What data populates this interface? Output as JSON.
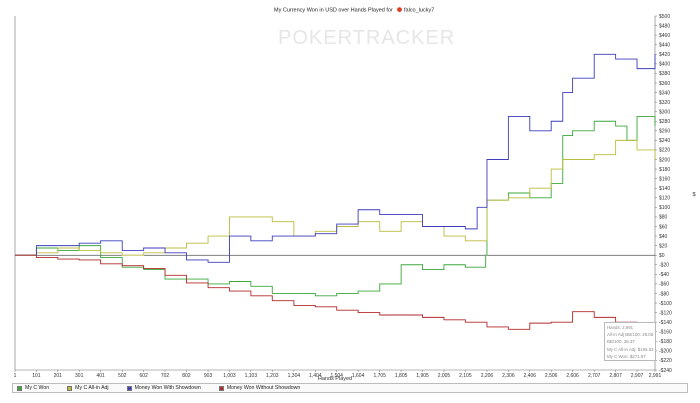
{
  "chart_data": {
    "type": "line",
    "title": "My Currency Won in USD over Hands Played for",
    "player_name": "falco_lucky7",
    "watermark": "POKERTRACKER",
    "xlabel": "Hands Played",
    "ylabel": "$",
    "xlim": [
      1,
      2991
    ],
    "ylim": [
      -240,
      500
    ],
    "x_ticks": [
      1,
      101,
      201,
      301,
      401,
      502,
      602,
      702,
      802,
      903,
      1003,
      1103,
      1203,
      1304,
      1404,
      1504,
      1604,
      1705,
      1805,
      1905,
      2005,
      2105,
      2206,
      2306,
      2406,
      2506,
      2606,
      2707,
      2807,
      2907,
      2991
    ],
    "x_tick_labels": [
      "1",
      "101",
      "201",
      "301",
      "401",
      "502",
      "602",
      "702",
      "802",
      "903",
      "1,003",
      "1,103",
      "1,203",
      "1,304",
      "1,404",
      "1,504",
      "1,604",
      "1,705",
      "1,805",
      "1,905",
      "2,005",
      "2,105",
      "2,206",
      "2,306",
      "2,406",
      "2,506",
      "2,606",
      "2,707",
      "2,807",
      "2,907",
      "2,991"
    ],
    "y_ticks": [
      -240,
      -220,
      -200,
      -180,
      -160,
      -140,
      -120,
      -100,
      -80,
      -60,
      -40,
      -20,
      0,
      20,
      40,
      60,
      80,
      100,
      120,
      140,
      160,
      180,
      200,
      220,
      240,
      260,
      280,
      300,
      320,
      340,
      360,
      380,
      400,
      420,
      440,
      460,
      480,
      500
    ],
    "y_tick_labels": [
      "-$240",
      "-$220",
      "-$200",
      "-$180",
      "-$160",
      "-$140",
      "-$120",
      "-$100",
      "-$80",
      "-$60",
      "-$40",
      "-$20",
      "$0",
      "$20",
      "$40",
      "$60",
      "$80",
      "$100",
      "$120",
      "$140",
      "$160",
      "$180",
      "$200",
      "$220",
      "$240",
      "$260",
      "$280",
      "$300",
      "$320",
      "$340",
      "$360",
      "$380",
      "$400",
      "$420",
      "$440",
      "$460",
      "$480",
      "$500"
    ],
    "grid": false,
    "legend_position": "bottom",
    "series": [
      {
        "name": "My C Won",
        "color": "#3aa83a",
        "x": [
          1,
          101,
          201,
          301,
          401,
          502,
          602,
          702,
          802,
          903,
          1003,
          1103,
          1203,
          1304,
          1404,
          1504,
          1604,
          1705,
          1805,
          1905,
          2005,
          2105,
          2160,
          2200,
          2206,
          2306,
          2406,
          2506,
          2560,
          2606,
          2707,
          2807,
          2860,
          2907,
          2991
        ],
        "y": [
          0,
          15,
          10,
          20,
          -5,
          -25,
          -30,
          -50,
          -50,
          -60,
          -55,
          -65,
          -80,
          -80,
          -85,
          -80,
          -75,
          -60,
          -20,
          -30,
          -20,
          -25,
          -25,
          0,
          115,
          130,
          120,
          150,
          250,
          260,
          280,
          270,
          240,
          290,
          270
        ]
      },
      {
        "name": "My C All-in Adj",
        "color": "#bcbc3c",
        "x": [
          1,
          101,
          201,
          301,
          401,
          502,
          602,
          702,
          802,
          903,
          1003,
          1103,
          1203,
          1304,
          1404,
          1504,
          1604,
          1705,
          1805,
          1905,
          2005,
          2105,
          2160,
          2206,
          2306,
          2406,
          2506,
          2560,
          2606,
          2707,
          2807,
          2907,
          2991
        ],
        "y": [
          0,
          5,
          15,
          10,
          5,
          0,
          5,
          15,
          25,
          40,
          80,
          80,
          70,
          40,
          50,
          60,
          70,
          50,
          70,
          60,
          40,
          30,
          30,
          115,
          120,
          140,
          180,
          200,
          200,
          210,
          240,
          220,
          200
        ]
      },
      {
        "name": "Money Won With Showdown",
        "color": "#3d3dbd",
        "x": [
          1,
          101,
          201,
          301,
          401,
          502,
          602,
          702,
          802,
          903,
          1003,
          1103,
          1203,
          1304,
          1404,
          1504,
          1604,
          1705,
          1805,
          1905,
          2005,
          2105,
          2160,
          2206,
          2306,
          2406,
          2506,
          2560,
          2606,
          2707,
          2807,
          2907,
          2991
        ],
        "y": [
          0,
          20,
          20,
          25,
          30,
          10,
          15,
          5,
          -10,
          -15,
          40,
          30,
          40,
          40,
          45,
          65,
          95,
          85,
          85,
          60,
          60,
          55,
          100,
          200,
          290,
          260,
          280,
          340,
          370,
          420,
          410,
          390,
          420
        ]
      },
      {
        "name": "Money Won Without Showdown",
        "color": "#b22a2a",
        "x": [
          1,
          101,
          201,
          301,
          401,
          502,
          602,
          702,
          802,
          903,
          1003,
          1103,
          1203,
          1304,
          1404,
          1504,
          1604,
          1705,
          1805,
          1905,
          2005,
          2105,
          2206,
          2306,
          2406,
          2506,
          2606,
          2707,
          2807,
          2907,
          2991
        ],
        "y": [
          0,
          -5,
          -8,
          -10,
          -18,
          -22,
          -28,
          -42,
          -58,
          -68,
          -75,
          -85,
          -95,
          -105,
          -108,
          -115,
          -120,
          -125,
          -125,
          -130,
          -135,
          -140,
          -150,
          -155,
          -142,
          -140,
          -118,
          -130,
          -140,
          -145,
          -160
        ]
      }
    ]
  },
  "tooltip": {
    "lines": [
      "Hands: 2,991",
      "All-in Adj BB/100: 28.08",
      "BB/100: 36.37",
      "My C All-in Adj: $195.02",
      "My C Won: $271.97"
    ]
  }
}
